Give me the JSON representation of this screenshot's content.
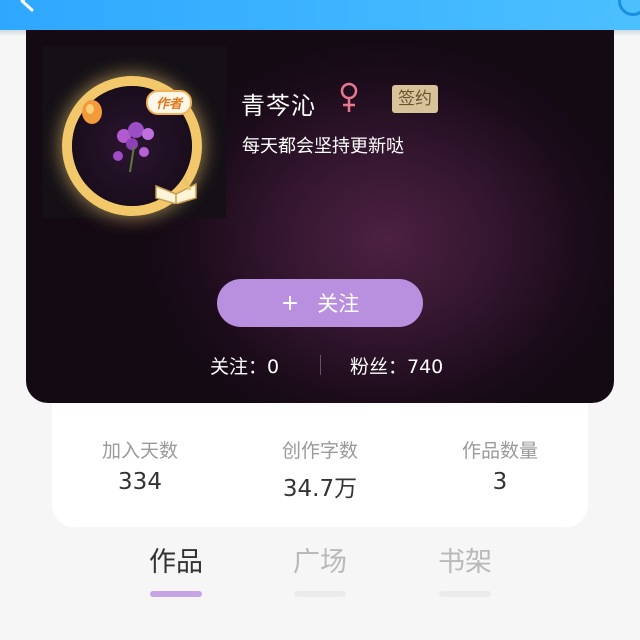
{
  "author": {
    "name": "青芩沁",
    "gender_symbol": "♀",
    "sign_badge": "签约",
    "bio": "每天都会坚持更新哒",
    "avatar_badge": "作者"
  },
  "follow_button": {
    "plus": "+",
    "label": "关注"
  },
  "counts": {
    "follow": "关注：0",
    "fans": "粉丝：740"
  },
  "stats": [
    {
      "label": "加入天数",
      "value": "334"
    },
    {
      "label": "创作字数",
      "value": "34.7万"
    },
    {
      "label": "作品数量",
      "value": "3"
    }
  ],
  "tabs": [
    {
      "label": "作品",
      "active": true
    },
    {
      "label": "广场",
      "active": false
    },
    {
      "label": "书架",
      "active": false
    }
  ],
  "colors": {
    "nav_bar": "#2ea7ff",
    "follow_button": "#b98fe0",
    "gender": "#e8788f",
    "sign_badge": "#d7c29a",
    "active_tab_underline": "#c7a4e6"
  },
  "icons": {
    "back": "back-arrow-icon",
    "gender": "female-icon"
  }
}
